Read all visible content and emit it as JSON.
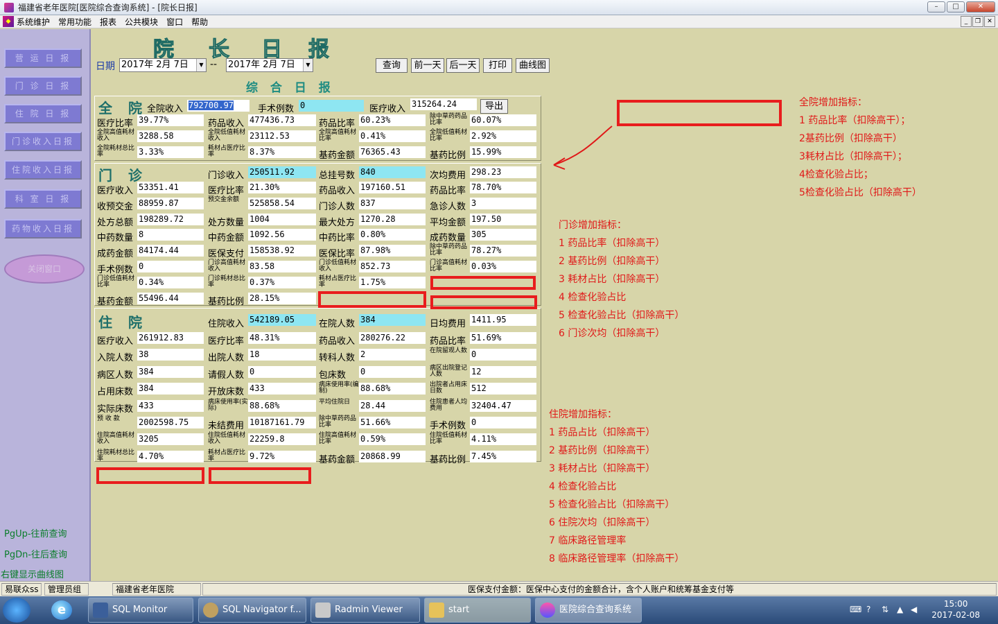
{
  "window": {
    "title": "福建省老年医院[医院综合查询系统] - [院长日报]",
    "min": "–",
    "max": "□",
    "close": "✕"
  },
  "menu": [
    "系统维护",
    "常用功能",
    "报表",
    "公共模块",
    "窗口",
    "帮助"
  ],
  "nav": [
    "营 运 日 报",
    "门 诊 日 报",
    "住 院 日 报",
    "门诊收入日报",
    "住院收入日报",
    "科 室 日 报",
    "药物收入日报",
    "关闭窗口"
  ],
  "hints": [
    "PgUp-往前查询",
    "PgDn-往后查询",
    "右键显示曲线图"
  ],
  "header": {
    "title_chars": [
      "院",
      "长",
      "日",
      "报"
    ],
    "date_label": "日期",
    "date_from": "2017年 2月 7日",
    "sep": "--",
    "date_to": "2017年 2月 7日",
    "btn_query": "查询",
    "btn_prev": "前一天",
    "btn_next": "后一天",
    "btn_print": "打印",
    "btn_chart": "曲线图",
    "subtitle": "综 合 日 报"
  },
  "hospital": {
    "name": "全 院",
    "total_label": "全院收入",
    "total": "792700.97",
    "surg_label": "手术例数",
    "surg": "0",
    "med_label": "医疗收入",
    "med": "315264.24",
    "export": "导出",
    "rows": [
      [
        "医疗比率",
        "39.77%",
        "药品收入",
        "477436.73",
        "药品比率",
        "60.23%",
        "除中草药药品比率",
        "60.07%"
      ],
      [
        "全院高值耗材收入",
        "3288.58",
        "全院低值耗材收入",
        "23112.53",
        "全院高值耗材比率",
        "0.41%",
        "全院低值耗材比率",
        "2.92%"
      ],
      [
        "全院耗材总比率",
        "3.33%",
        "耗材占医疗比率",
        "8.37%",
        "基药金额",
        "76365.43",
        "基药比例",
        "15.99%"
      ]
    ]
  },
  "outpatient": {
    "name": "门 诊",
    "h1l": "门诊收入",
    "h1v": "250511.92",
    "h2l": "总挂号数",
    "h2v": "840",
    "h3l": "次均费用",
    "h3v": "298.23",
    "rows": [
      [
        "医疗收入",
        "53351.41",
        "医疗比率",
        "21.30%",
        "药品收入",
        "197160.51",
        "药品比率",
        "78.70%"
      ],
      [
        "收预交金",
        "88959.87",
        "预交金余额",
        "525858.54",
        "门诊人数",
        "837",
        "急诊人数",
        "3"
      ],
      [
        "处方总额",
        "198289.72",
        "处方数量",
        "1004",
        "最大处方",
        "1270.28",
        "平均金额",
        "197.50"
      ],
      [
        "中药数量",
        "8",
        "中药金额",
        "1092.56",
        "中药比率",
        "0.80%",
        "成药数量",
        "305"
      ],
      [
        "成药金额",
        "84174.44",
        "医保支付",
        "158538.92",
        "医保比率",
        "87.98%",
        "除中草药药品比率",
        "78.27%"
      ],
      [
        "手术例数",
        "0",
        "门诊高值耗材收入",
        "83.58",
        "门诊低值耗材收入",
        "852.73",
        "门诊高值耗材比率",
        "0.03%"
      ],
      [
        "门诊低值耗材比率",
        "0.34%",
        "门诊耗材总比率",
        "0.37%",
        "耗材占医疗比率",
        "1.75%",
        "",
        ""
      ],
      [
        "基药金额",
        "55496.44",
        "基药比例",
        "28.15%",
        "",
        "",
        "",
        ""
      ]
    ]
  },
  "inpatient": {
    "name": "住 院",
    "h1l": "住院收入",
    "h1v": "542189.05",
    "h2l": "在院人数",
    "h2v": "384",
    "h3l": "日均费用",
    "h3v": "1411.95",
    "rows": [
      [
        "医疗收入",
        "261912.83",
        "医疗比率",
        "48.31%",
        "药品收入",
        "280276.22",
        "药品比率",
        "51.69%"
      ],
      [
        "入院人数",
        "38",
        "出院人数",
        "18",
        "转科人数",
        "2",
        "在院留观人数",
        "0"
      ],
      [
        "病区人数",
        "384",
        "请假人数",
        "0",
        "包床数",
        "0",
        "病区出院登记人数",
        "12"
      ],
      [
        "占用床数",
        "384",
        "开放床数",
        "433",
        "病床使用率(编制)",
        "88.68%",
        "出院者占用床日数",
        "512"
      ],
      [
        "实际床数",
        "433",
        "病床使用率(实际)",
        "88.68%",
        "平均住院日",
        "28.44",
        "住院患者人均费用",
        "32404.47"
      ],
      [
        "预 收 款",
        "2002598.75",
        "未结费用",
        "10187161.79",
        "除中草药药品比率",
        "51.66%",
        "手术例数",
        "0"
      ],
      [
        "住院高值耗材收入",
        "3205",
        "住院低值耗材收入",
        "22259.8",
        "住院高值耗材比率",
        "0.59%",
        "住院低值耗材比率",
        "4.11%"
      ],
      [
        "住院耗材总比率",
        "4.70%",
        "耗材占医疗比率",
        "9.72%",
        "基药金额",
        "20868.99",
        "基药比例",
        "7.45%"
      ]
    ]
  },
  "notes": {
    "hospital": [
      "全院增加指标：",
      "1 药品比率（扣除高干）；",
      "2基药比例（扣除高干）",
      "3耗材占比（扣除高干）；",
      "4检查化验占比；",
      "5检查化验占比（扣除高干）"
    ],
    "outpatient": [
      "门诊增加指标：",
      "1 药品比率（扣除高干）",
      "2 基药比例（扣除高干）",
      "3 耗材占比（扣除高干）",
      "4 检查化验占比",
      "5 检查化验占比（扣除高干）",
      "6 门诊次均（扣除高干）"
    ],
    "inpatient": [
      "住院增加指标：",
      "1 药品占比（扣除高干）",
      "2 基药比例（扣除高干）",
      "3 耗材占比（扣除高干）",
      "4 检查化验占比",
      "5 检查化验占比（扣除高干）",
      "6 住院次均（扣除高干）",
      "7 临床路径管理率",
      "8 临床路径管理率（扣除高干）"
    ]
  },
  "status": {
    "user": "易联众ss",
    "group": "管理员组",
    "org": "福建省老年医院",
    "msg": "医保支付金额：医保中心支付的金额合计，含个人账户和统筹基金支付等"
  },
  "taskbar": {
    "items": [
      "SQL Monitor",
      "SQL Navigator f...",
      "Radmin Viewer",
      "start",
      "医院综合查询系统"
    ],
    "time": "15:00",
    "date": "2017-02-08"
  }
}
